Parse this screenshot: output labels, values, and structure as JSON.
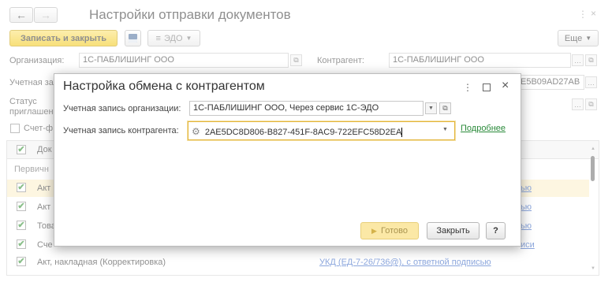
{
  "main_window": {
    "title": "Настройки отправки документов",
    "toolbar": {
      "save_close_label": "Записать и закрыть",
      "edo_label": "ЭДО",
      "more_label": "Еще"
    },
    "form": {
      "organization_label": "Организация:",
      "organization_value": "1С-ПАБЛИШИНГ ООО",
      "counterparty_label": "Контрагент:",
      "counterparty_value": "1С-ПАБЛИШИНГ ООО",
      "account_label": "Учетная за",
      "account_value_tail": "E5B09AD27AB",
      "status_label_1": "Статус",
      "status_label_2": "приглашен",
      "invoice_check_label": "Счет-ф"
    },
    "table": {
      "header_col": "Док",
      "group_label": "Первичн",
      "rows": [
        {
          "label": "Акт",
          "link": "ью"
        },
        {
          "label": "Акт",
          "link": "ью"
        },
        {
          "label": "Това",
          "link": "ью"
        },
        {
          "label": "Сче",
          "link": "иси"
        },
        {
          "label": "Акт, накладная (Корректировка)",
          "link": "УКД (ЕД-7-26/736@), с ответной подписью"
        }
      ]
    }
  },
  "dialog": {
    "title": "Настройка обмена с контрагентом",
    "org_account_label": "Учетная запись организации:",
    "org_account_value": "1С-ПАБЛИШИНГ ООО, Через сервис 1С-ЭДО",
    "cp_account_label": "Учетная запись контрагента:",
    "cp_account_value": "2AE5DC8D806-B827-451F-8AC9-722EFC58D2EA",
    "more_link": "Подробнее",
    "done_label": "Готово",
    "close_label": "Закрыть",
    "help_label": "?"
  },
  "colors": {
    "primary_button": "#f5d12a",
    "link": "#2d5ec1",
    "more_link": "#2a8a3a",
    "focus_border": "#e3b53a"
  }
}
